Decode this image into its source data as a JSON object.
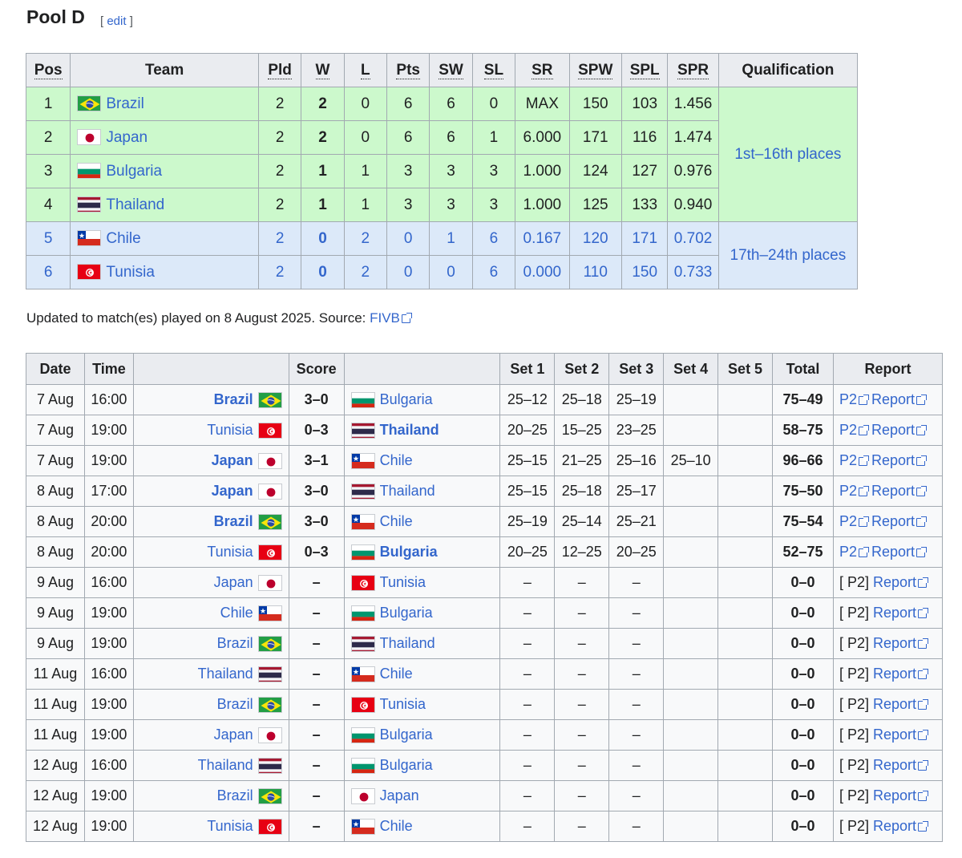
{
  "page": {
    "title": "Pool D",
    "edit_open": "[ ",
    "edit_label": "edit",
    "edit_close": " ]"
  },
  "standings": {
    "headers": [
      "Pos",
      "Team",
      "Pld",
      "W",
      "L",
      "Pts",
      "SW",
      "SL",
      "SR",
      "SPW",
      "SPL",
      "SPR",
      "Qualification"
    ],
    "qualification": [
      "1st–16th places",
      "17th–24th places"
    ],
    "rows": [
      {
        "pos": "1",
        "team": "Brazil",
        "flag": "brazil-flag-icon",
        "pld": "2",
        "w": "2",
        "l": "0",
        "pts": "6",
        "sw": "6",
        "sl": "0",
        "sr": "MAX",
        "spw": "150",
        "spl": "103",
        "spr": "1.456"
      },
      {
        "pos": "2",
        "team": "Japan",
        "flag": "japan-flag-icon",
        "pld": "2",
        "w": "2",
        "l": "0",
        "pts": "6",
        "sw": "6",
        "sl": "1",
        "sr": "6.000",
        "spw": "171",
        "spl": "116",
        "spr": "1.474"
      },
      {
        "pos": "3",
        "team": "Bulgaria",
        "flag": "bulgaria-flag-icon",
        "pld": "2",
        "w": "1",
        "l": "1",
        "pts": "3",
        "sw": "3",
        "sl": "3",
        "sr": "1.000",
        "spw": "124",
        "spl": "127",
        "spr": "0.976"
      },
      {
        "pos": "4",
        "team": "Thailand",
        "flag": "thailand-flag-icon",
        "pld": "2",
        "w": "1",
        "l": "1",
        "pts": "3",
        "sw": "3",
        "sl": "3",
        "sr": "1.000",
        "spw": "125",
        "spl": "133",
        "spr": "0.940"
      },
      {
        "pos": "5",
        "team": "Chile",
        "flag": "chile-flag-icon",
        "pld": "2",
        "w": "0",
        "l": "2",
        "pts": "0",
        "sw": "1",
        "sl": "6",
        "sr": "0.167",
        "spw": "120",
        "spl": "171",
        "spr": "0.702"
      },
      {
        "pos": "6",
        "team": "Tunisia",
        "flag": "tunisia-flag-icon",
        "pld": "2",
        "w": "0",
        "l": "2",
        "pts": "0",
        "sw": "0",
        "sl": "6",
        "sr": "0.000",
        "spw": "110",
        "spl": "150",
        "spr": "0.733"
      }
    ],
    "colors": {
      "top_group": "#ccf9cc",
      "bottom_group": "#dce9f9",
      "header": "#eaecf0"
    }
  },
  "note": {
    "text": "Updated to match(es) played on 8 August 2025. Source: ",
    "source_label": "FIVB"
  },
  "matches": {
    "headers": [
      "Date",
      "Time",
      "",
      "Score",
      "",
      "Set 1",
      "Set 2",
      "Set 3",
      "Set 4",
      "Set 5",
      "Total",
      "Report"
    ],
    "rows": [
      {
        "date": "7 Aug",
        "time": "16:00",
        "home": "Brazil",
        "home_flag": "brazil",
        "score": "3–0",
        "away": "Bulgaria",
        "away_flag": "bulgaria",
        "winner": "home",
        "set1": "25–12",
        "set2": "25–18",
        "set3": "25–19",
        "set4": "",
        "set5": "",
        "total": "75–49",
        "p2": "P2",
        "report": "Report",
        "played": true
      },
      {
        "date": "7 Aug",
        "time": "19:00",
        "home": "Tunisia",
        "home_flag": "tunisia",
        "score": "0–3",
        "away": "Thailand",
        "away_flag": "thailand",
        "winner": "away",
        "set1": "20–25",
        "set2": "15–25",
        "set3": "23–25",
        "set4": "",
        "set5": "",
        "total": "58–75",
        "p2": "P2",
        "report": "Report",
        "played": true
      },
      {
        "date": "7 Aug",
        "time": "19:00",
        "home": "Japan",
        "home_flag": "japan",
        "score": "3–1",
        "away": "Chile",
        "away_flag": "chile",
        "winner": "home",
        "set1": "25–15",
        "set2": "21–25",
        "set3": "25–16",
        "set4": "25–10",
        "set5": "",
        "total": "96–66",
        "p2": "P2",
        "report": "Report",
        "played": true
      },
      {
        "date": "8 Aug",
        "time": "17:00",
        "home": "Japan",
        "home_flag": "japan",
        "score": "3–0",
        "away": "Thailand",
        "away_flag": "thailand",
        "winner": "home",
        "set1": "25–15",
        "set2": "25–18",
        "set3": "25–17",
        "set4": "",
        "set5": "",
        "total": "75–50",
        "p2": "P2",
        "report": "Report",
        "played": true
      },
      {
        "date": "8 Aug",
        "time": "20:00",
        "home": "Brazil",
        "home_flag": "brazil",
        "score": "3–0",
        "away": "Chile",
        "away_flag": "chile",
        "winner": "home",
        "set1": "25–19",
        "set2": "25–14",
        "set3": "25–21",
        "set4": "",
        "set5": "",
        "total": "75–54",
        "p2": "P2",
        "report": "Report",
        "played": true
      },
      {
        "date": "8 Aug",
        "time": "20:00",
        "home": "Tunisia",
        "home_flag": "tunisia",
        "score": "0–3",
        "away": "Bulgaria",
        "away_flag": "bulgaria",
        "winner": "away",
        "set1": "20–25",
        "set2": "12–25",
        "set3": "20–25",
        "set4": "",
        "set5": "",
        "total": "52–75",
        "p2": "P2",
        "report": "Report",
        "played": true
      },
      {
        "date": "9 Aug",
        "time": "16:00",
        "home": "Japan",
        "home_flag": "japan",
        "score": "–",
        "away": "Tunisia",
        "away_flag": "tunisia",
        "winner": "",
        "set1": "–",
        "set2": "–",
        "set3": "–",
        "set4": "",
        "set5": "",
        "total": "0–0",
        "p2": "[ P2]",
        "report": "Report",
        "played": false
      },
      {
        "date": "9 Aug",
        "time": "19:00",
        "home": "Chile",
        "home_flag": "chile",
        "score": "–",
        "away": "Bulgaria",
        "away_flag": "bulgaria",
        "winner": "",
        "set1": "–",
        "set2": "–",
        "set3": "–",
        "set4": "",
        "set5": "",
        "total": "0–0",
        "p2": "[ P2]",
        "report": "Report",
        "played": false
      },
      {
        "date": "9 Aug",
        "time": "19:00",
        "home": "Brazil",
        "home_flag": "brazil",
        "score": "–",
        "away": "Thailand",
        "away_flag": "thailand",
        "winner": "",
        "set1": "–",
        "set2": "–",
        "set3": "–",
        "set4": "",
        "set5": "",
        "total": "0–0",
        "p2": "[ P2]",
        "report": "Report",
        "played": false
      },
      {
        "date": "11 Aug",
        "time": "16:00",
        "home": "Thailand",
        "home_flag": "thailand",
        "score": "–",
        "away": "Chile",
        "away_flag": "chile",
        "winner": "",
        "set1": "–",
        "set2": "–",
        "set3": "–",
        "set4": "",
        "set5": "",
        "total": "0–0",
        "p2": "[ P2]",
        "report": "Report",
        "played": false
      },
      {
        "date": "11 Aug",
        "time": "19:00",
        "home": "Brazil",
        "home_flag": "brazil",
        "score": "–",
        "away": "Tunisia",
        "away_flag": "tunisia",
        "winner": "",
        "set1": "–",
        "set2": "–",
        "set3": "–",
        "set4": "",
        "set5": "",
        "total": "0–0",
        "p2": "[ P2]",
        "report": "Report",
        "played": false
      },
      {
        "date": "11 Aug",
        "time": "19:00",
        "home": "Japan",
        "home_flag": "japan",
        "score": "–",
        "away": "Bulgaria",
        "away_flag": "bulgaria",
        "winner": "",
        "set1": "–",
        "set2": "–",
        "set3": "–",
        "set4": "",
        "set5": "",
        "total": "0–0",
        "p2": "[ P2]",
        "report": "Report",
        "played": false
      },
      {
        "date": "12 Aug",
        "time": "16:00",
        "home": "Thailand",
        "home_flag": "thailand",
        "score": "–",
        "away": "Bulgaria",
        "away_flag": "bulgaria",
        "winner": "",
        "set1": "–",
        "set2": "–",
        "set3": "–",
        "set4": "",
        "set5": "",
        "total": "0–0",
        "p2": "[ P2]",
        "report": "Report",
        "played": false
      },
      {
        "date": "12 Aug",
        "time": "19:00",
        "home": "Brazil",
        "home_flag": "brazil",
        "score": "–",
        "away": "Japan",
        "away_flag": "japan",
        "winner": "",
        "set1": "–",
        "set2": "–",
        "set3": "–",
        "set4": "",
        "set5": "",
        "total": "0–0",
        "p2": "[ P2]",
        "report": "Report",
        "played": false
      },
      {
        "date": "12 Aug",
        "time": "19:00",
        "home": "Tunisia",
        "home_flag": "tunisia",
        "score": "–",
        "away": "Chile",
        "away_flag": "chile",
        "winner": "",
        "set1": "–",
        "set2": "–",
        "set3": "–",
        "set4": "",
        "set5": "",
        "total": "0–0",
        "p2": "[ P2]",
        "report": "Report",
        "played": false
      }
    ]
  },
  "link_color": "#3366cc"
}
